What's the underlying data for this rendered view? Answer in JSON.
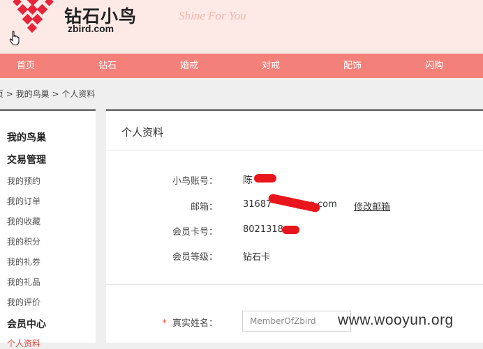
{
  "brand": {
    "name_cn": "钻石小鸟",
    "domain": "zbird.com",
    "slogan": "Shine For You",
    "accent_color": "#f38079"
  },
  "nav": {
    "items": [
      "首页",
      "钻石",
      "婚戒",
      "对戒",
      "配饰",
      "闪购"
    ]
  },
  "breadcrumb": {
    "text": "页 > 我的鸟巢 > 个人资料"
  },
  "sidebar": {
    "heading_nest": "我的鸟巢",
    "heading_trade": "交易管理",
    "trade_items": [
      "我的预约",
      "我的订单",
      "我的收藏",
      "我的积分",
      "我的礼券",
      "我的礼品",
      "我的评价"
    ],
    "heading_member": "会员中心",
    "partial_item": "个人资料"
  },
  "profile": {
    "title": "个人资料",
    "account_label": "小鸟账号：",
    "account_value": "陈",
    "email_label": "邮箱：",
    "email_value_start": "31687",
    "email_value_end": "@qq.com",
    "edit_email_link": "修改邮箱",
    "card_label": "会员卡号：",
    "card_value": "8021318",
    "level_label": "会员等级：",
    "level_value": "钻石卡",
    "realname_label": "真实姓名：",
    "realname_required": "*",
    "realname_value": "MemberOfZbird"
  },
  "watermark": "www.wooyun.org",
  "icons": {
    "logo": "diamond-lattice-logo-icon",
    "cursor": "hand-pointer-icon"
  },
  "colors": {
    "redaction": "#e8161c",
    "required": "#e04a3f"
  }
}
